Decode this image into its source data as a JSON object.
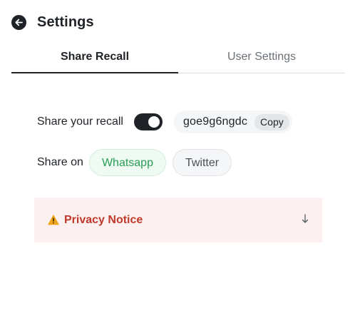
{
  "header": {
    "title": "Settings",
    "back_icon": "arrow-left-circle-icon"
  },
  "tabs": [
    {
      "label": "Share Recall",
      "active": true
    },
    {
      "label": "User Settings",
      "active": false
    }
  ],
  "share_recall": {
    "label": "Share your recall",
    "toggle_on": true,
    "code": "goe9g6ngdc",
    "copy_label": "Copy"
  },
  "share_on": {
    "label": "Share on",
    "buttons": [
      {
        "label": "Whatsapp",
        "color": "#2a9d57"
      },
      {
        "label": "Twitter",
        "color": "#4a5057"
      }
    ]
  },
  "privacy_notice": {
    "title": "Privacy Notice",
    "icon": "warning-icon",
    "expand_icon": "arrow-down-icon",
    "background": "#fdf0f0",
    "title_color": "#c0392b"
  },
  "colors": {
    "primary": "#1f2328",
    "muted": "#6b7178"
  }
}
